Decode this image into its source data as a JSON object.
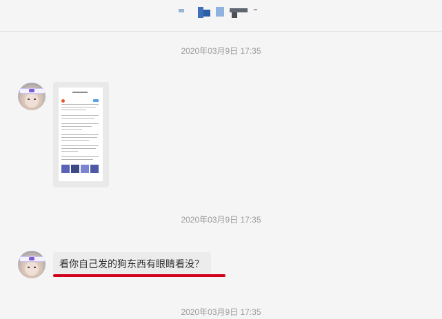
{
  "colors": {
    "background": "#f5f5f5",
    "bubble": "#ececec",
    "timestamp_text": "#9b9b9b",
    "message_text": "#333333",
    "annotation_underline": "#d0021b"
  },
  "header": {
    "contact_name_redacted": true
  },
  "messages": [
    {
      "timestamp": "2020年03月9日 17:35",
      "type": "image",
      "image_description": "screenshot thumbnail"
    },
    {
      "timestamp": "2020年03月9日 17:35",
      "type": "text",
      "text": "看你自己发的狗东西有眼睛看没？"
    },
    {
      "timestamp": "2020年03月9日 17:35"
    }
  ]
}
